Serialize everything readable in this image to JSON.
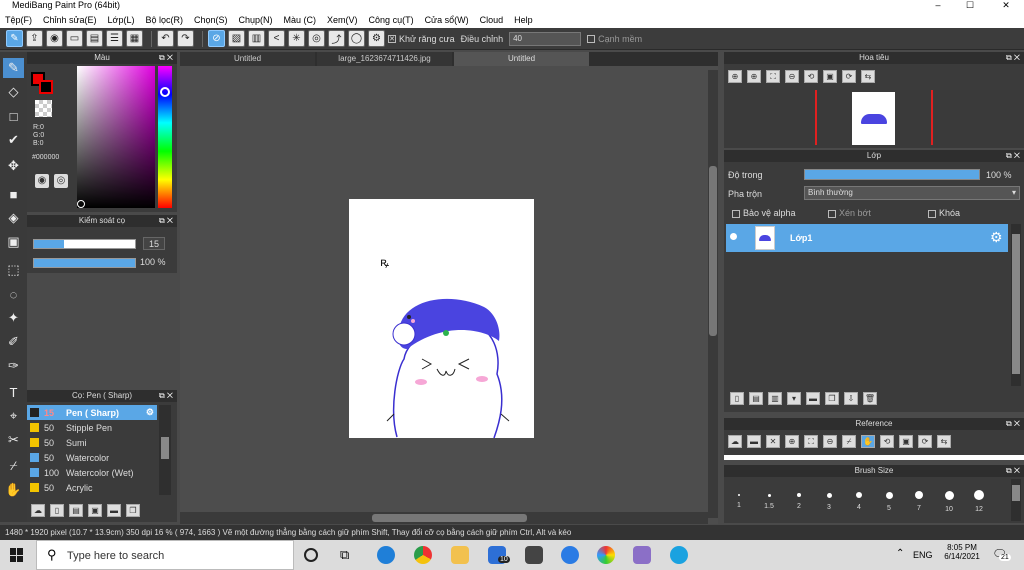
{
  "window": {
    "title": "MediBang Paint Pro (64bit)",
    "minimize": "–",
    "maximize": "☐",
    "close": "✕"
  },
  "menu": [
    "Tệp(F)",
    "Chỉnh sửa(E)",
    "Lớp(L)",
    "Bộ lọc(R)",
    "Chọn(S)",
    "Chụp(N)",
    "Màu (C)",
    "Xem(V)",
    "Công cụ(T)",
    "Cửa sổ(W)",
    "Cloud",
    "Help"
  ],
  "toolbar": {
    "antialias_label": "Khử răng cưa",
    "adjust_label": "Điều chỉnh",
    "adjust_value": "40",
    "snap_label": "Cạnh mềm"
  },
  "color_panel": {
    "title": "Màu",
    "r": "R:0",
    "g": "G:0",
    "b": "B:0",
    "hex": "#000000"
  },
  "brush_control": {
    "title": "Kiểm soát cọ",
    "size": "15",
    "opacity": "100 %"
  },
  "brush_panel": {
    "title": "Cọ: Pen ( Sharp)",
    "items": [
      {
        "size": "15",
        "name": "Pen ( Sharp)",
        "color": "#222222",
        "selected": true
      },
      {
        "size": "50",
        "name": "Stipple Pen",
        "color": "#f2c400"
      },
      {
        "size": "50",
        "name": "Sumi",
        "color": "#f2c400"
      },
      {
        "size": "50",
        "name": "Watercolor",
        "color": "#5aa7e6"
      },
      {
        "size": "100",
        "name": "Watercolor (Wet)",
        "color": "#5aa7e6"
      },
      {
        "size": "50",
        "name": "Acrylic",
        "color": "#f2c400"
      }
    ]
  },
  "tabs": [
    "Untitled",
    "large_1623674711426.jpg",
    "Untitled"
  ],
  "navigator": {
    "title": "Hoa tiêu"
  },
  "layer_panel": {
    "title": "Lớp",
    "opacity_label": "Độ trong",
    "opacity_value": "100 %",
    "blend_label": "Pha trộn",
    "blend_value": "Bình thường",
    "protect_alpha": "Bảo vệ alpha",
    "clip": "Xén bớt",
    "lock": "Khóa",
    "layer_name": "Lớp1"
  },
  "reference": {
    "title": "Reference"
  },
  "brush_size": {
    "title": "Brush Size",
    "sizes": [
      "1",
      "1.5",
      "2",
      "3",
      "4",
      "5",
      "7",
      "10",
      "12"
    ]
  },
  "status": {
    "text": "1480 * 1920 pixel   (10.7 * 13.9cm)   350 dpi   16 %   ( 974, 1663 )   Vẽ một đường thẳng bằng cách giữ phím Shift, Thay đổi cỡ cọ bằng cách giữ phím Ctrl, Alt và kéo"
  },
  "taskbar": {
    "search": "Type here to search",
    "lang": "ENG",
    "time": "8:05 PM",
    "date": "6/14/2021",
    "notif": "21",
    "mail_badge": "10"
  },
  "colors": {
    "accent": "#5aa7e6",
    "hat": "#4a44e0"
  }
}
